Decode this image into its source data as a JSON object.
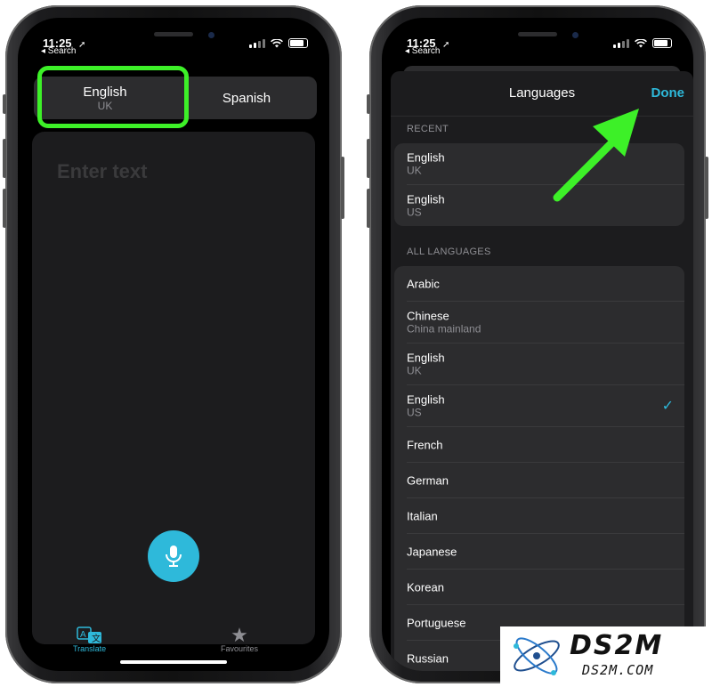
{
  "status": {
    "time": "11:25",
    "back_label": "◂ Search"
  },
  "left_screen": {
    "source_lang": {
      "name": "English",
      "region": "UK"
    },
    "target_lang": {
      "name": "Spanish"
    },
    "input_placeholder": "Enter text",
    "tabs": [
      {
        "label": "Translate",
        "icon": "translate-icon",
        "active": true
      },
      {
        "label": "Favourites",
        "icon": "star-icon",
        "active": false
      }
    ]
  },
  "right_screen": {
    "sheet_title": "Languages",
    "done_label": "Done",
    "recent_header": "RECENT",
    "recent": [
      {
        "name": "English",
        "region": "UK"
      },
      {
        "name": "English",
        "region": "US"
      }
    ],
    "all_header": "ALL LANGUAGES",
    "all": [
      {
        "name": "Arabic"
      },
      {
        "name": "Chinese",
        "region": "China mainland"
      },
      {
        "name": "English",
        "region": "UK"
      },
      {
        "name": "English",
        "region": "US",
        "selected": true
      },
      {
        "name": "French"
      },
      {
        "name": "German"
      },
      {
        "name": "Italian"
      },
      {
        "name": "Japanese"
      },
      {
        "name": "Korean"
      },
      {
        "name": "Portuguese"
      },
      {
        "name": "Russian"
      }
    ]
  },
  "watermark": {
    "brand": "DS2M",
    "url": "DS2M.COM"
  },
  "colors": {
    "accent": "#2eb9da",
    "highlight": "#3df028",
    "background": "#000000"
  }
}
